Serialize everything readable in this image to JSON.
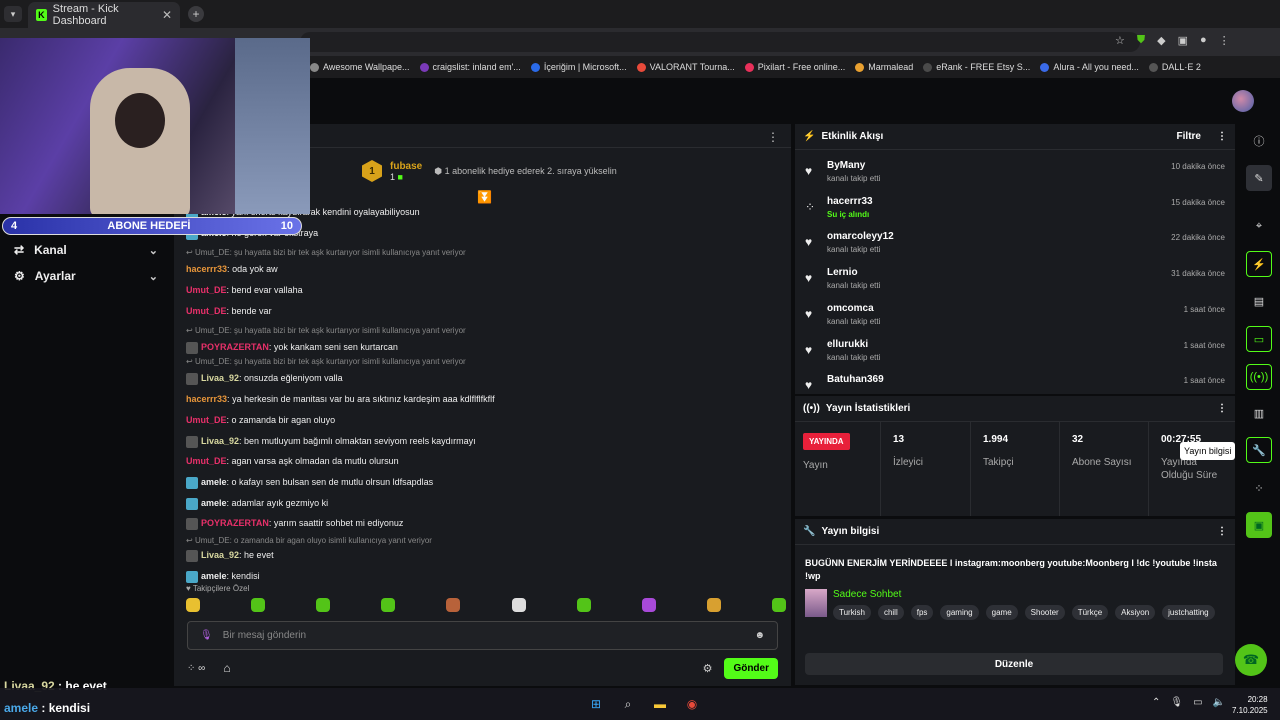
{
  "browser": {
    "tab_title": "Stream - Kick Dashboard",
    "close": "✕",
    "new_tab": "+",
    "bookmarks": [
      {
        "label": "Awesome Wallpape...",
        "color": "#888888"
      },
      {
        "label": "craigslist: inland em'...",
        "color": "#7a3ab8"
      },
      {
        "label": "İçeriğim | Microsoft...",
        "color": "#2a6ae8"
      },
      {
        "label": "VALORANT Tourna...",
        "color": "#e84a3a"
      },
      {
        "label": "Pixilart - Free online...",
        "color": "#e8305a"
      },
      {
        "label": "Marmalead",
        "color": "#e8a030"
      },
      {
        "label": "eRank - FREE Etsy S...",
        "color": "#4a4a4a"
      },
      {
        "label": "Alura - All you need...",
        "color": "#3a6ae8"
      },
      {
        "label": "DALL·E 2",
        "color": "#555555"
      }
    ]
  },
  "overlay": {
    "sub_current": "4",
    "sub_label": "ABONE HEDEFİ",
    "sub_target": "10"
  },
  "sidebar": {
    "items": [
      {
        "label": "Kanal"
      },
      {
        "label": "Ayarlar"
      }
    ]
  },
  "chat": {
    "pinned": {
      "badge": "1",
      "name": "fubase",
      "count": "1",
      "message": "1 abonelik hediye ederek 2. sıraya yükselin"
    },
    "follower_only": "Takipçilere Özel",
    "input_placeholder": "Bir mesaj gönderin",
    "infinity": "∞",
    "send_label": "Gönder",
    "lines": [
      {
        "user": "amele",
        "color": "#eeeeee",
        "text": "yanı shorts kaydırarak kendini oyalayabiliyosun",
        "badge": "blue"
      },
      {
        "user": "amele",
        "color": "#eeeeee",
        "text": "ne gerek var ekstraya",
        "badge": "blue"
      },
      {
        "reply": "Umut_DE: şu hayatta bizi bir tek aşk kurtarıyor isimli kullanıcıya yanıt veriyor"
      },
      {
        "user": "hacerrr33",
        "color": "#e8963a",
        "text": "oda yok aw",
        "badge": ""
      },
      {
        "user": "Umut_DE",
        "color": "#e8306a",
        "text": "bend evar vallaha",
        "badge": ""
      },
      {
        "user": "Umut_DE",
        "color": "#e8306a",
        "text": "bende var",
        "badge": ""
      },
      {
        "reply": "Umut_DE: şu hayatta bizi bir tek aşk kurtarıyor isimli kullanıcıya yanıt veriyor"
      },
      {
        "user": "POYRAZERTAN",
        "color": "#e8306a",
        "text": "yok kankam seni sen kurtarcan",
        "badge": "gray"
      },
      {
        "reply": "Umut_DE: şu hayatta bizi bir tek aşk kurtarıyor isimli kullanıcıya yanıt veriyor"
      },
      {
        "user": "Livaa_92",
        "color": "#d8d8a0",
        "text": "onsuzda eğleniyom valla",
        "badge": "gray"
      },
      {
        "user": "hacerrr33",
        "color": "#e8963a",
        "text": "ya herkesin de manitası var bu ara sıktınız kardeşim aaa kdlflflfkflf",
        "badge": ""
      },
      {
        "user": "Umut_DE",
        "color": "#e8306a",
        "text": "o zamanda bir agan oluyo",
        "badge": ""
      },
      {
        "user": "Livaa_92",
        "color": "#d8d8a0",
        "text": "ben mutluyum bağımlı olmaktan seviyom reels kaydırmayı",
        "badge": "gray"
      },
      {
        "user": "Umut_DE",
        "color": "#e8306a",
        "text": "agan varsa aşk olmadan da mutlu olursun",
        "badge": ""
      },
      {
        "user": "amele",
        "color": "#eeeeee",
        "text": "o kafayı sen bulsan sen de mutlu olrsun ldfsapdlas",
        "badge": "blue"
      },
      {
        "user": "amele",
        "color": "#eeeeee",
        "text": "adamlar ayık gezmiyo ki",
        "badge": "blue"
      },
      {
        "user": "POYRAZERTAN",
        "color": "#e8306a",
        "text": "yarım saattir sohbet mi ediyonuz",
        "badge": "gray"
      },
      {
        "reply": "Umut_DE: o zamanda bir agan oluyo isimli kullanıcıya yanıt veriyor"
      },
      {
        "user": "Livaa_92",
        "color": "#d8d8a0",
        "text": "he evet",
        "badge": "gray"
      },
      {
        "user": "amele",
        "color": "#eeeeee",
        "text": "kendisi",
        "badge": "blue"
      }
    ]
  },
  "activity": {
    "title": "Etkinlik Akışı",
    "filter": "Filtre",
    "items": [
      {
        "name": "ByMany",
        "sub": "kanalı takip etti",
        "time": "10 dakika önce",
        "green": false
      },
      {
        "name": "hacerrr33",
        "sub": "Su iç alındı",
        "time": "15 dakika önce",
        "green": true
      },
      {
        "name": "omarcoleyy12",
        "sub": "kanalı takip etti",
        "time": "22 dakika önce",
        "green": false
      },
      {
        "name": "Lernio",
        "sub": "kanalı takip etti",
        "time": "31 dakika önce",
        "green": false
      },
      {
        "name": "omcomca",
        "sub": "kanalı takip etti",
        "time": "1 saat önce",
        "green": false
      },
      {
        "name": "ellurukki",
        "sub": "kanalı takip etti",
        "time": "1 saat önce",
        "green": false
      },
      {
        "name": "Batuhan369",
        "sub": "",
        "time": "1 saat önce",
        "green": false
      }
    ]
  },
  "stats": {
    "title": "Yayın İstatistikleri",
    "live_badge": "YAYINDA",
    "live_label": "Yayın",
    "items": [
      {
        "value": "13",
        "label": "İzleyici"
      },
      {
        "value": "1.994",
        "label": "Takipçi"
      },
      {
        "value": "32",
        "label": "Abone Sayısı"
      },
      {
        "value": "00:27:55",
        "label": "Yayında Olduğu Süre"
      }
    ]
  },
  "stream_info": {
    "title_label": "Yayın bilgisi",
    "stream_title": "BUGÜNN ENERJİM YERİNDEEEE l instagram:moonberg youtube:Moonberg l !dc !youtube !insta !wp",
    "category": "Sadece Sohbet",
    "tags": [
      "Turkish",
      "chill",
      "fps",
      "gaming",
      "game",
      "Shooter",
      "Türkçe",
      "Aksiyon",
      "justchatting"
    ],
    "edit_label": "Düzenle"
  },
  "rail": {
    "tooltip": "Yayın bilgisi"
  },
  "overlay_chat": [
    {
      "user": "Livaa_92",
      "text": " : he evet"
    },
    {
      "user": "amele",
      "text": " : kendisi"
    }
  ],
  "taskbar": {
    "time": "20:28",
    "date": "7.10.2025"
  },
  "colors": {
    "accent": "#53fc18",
    "live": "#e8203a",
    "panel": "#191b1f"
  }
}
